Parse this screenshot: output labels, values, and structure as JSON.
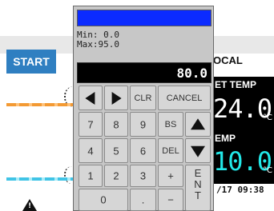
{
  "background": {
    "start_label": "START",
    "local_label": "OCAL",
    "set_temp_label": "ET TEMP",
    "set_temp_value": "24.0",
    "temp_label": "EMP",
    "temp_value": "10.0",
    "unit": "°C",
    "datetime": "/17 09:38",
    "warning_icon": "warning-triangle-icon"
  },
  "keypad": {
    "title_color": "#0b2bff",
    "min_text": "Min: 0.0",
    "max_text": "Max:95.0",
    "display_value": "80.0",
    "keys": {
      "left": "arrow-left-icon",
      "right": "arrow-right-icon",
      "clr": "CLR",
      "cancel": "CANCEL",
      "k7": "7",
      "k8": "8",
      "k9": "9",
      "bs": "BS",
      "up": "arrow-up-icon",
      "k4": "4",
      "k5": "5",
      "k6": "6",
      "del": "DEL",
      "down": "arrow-down-icon",
      "k1": "1",
      "k2": "2",
      "k3": "3",
      "plus": "+",
      "enter": "ENT",
      "k0": "0",
      "dot": ".",
      "minus": "−"
    }
  },
  "colors": {
    "start_button": "#2f7fc1",
    "temp_cyan": "#22e8e8",
    "hot_line": "#f39a34",
    "cold_line": "#40c4e6"
  }
}
